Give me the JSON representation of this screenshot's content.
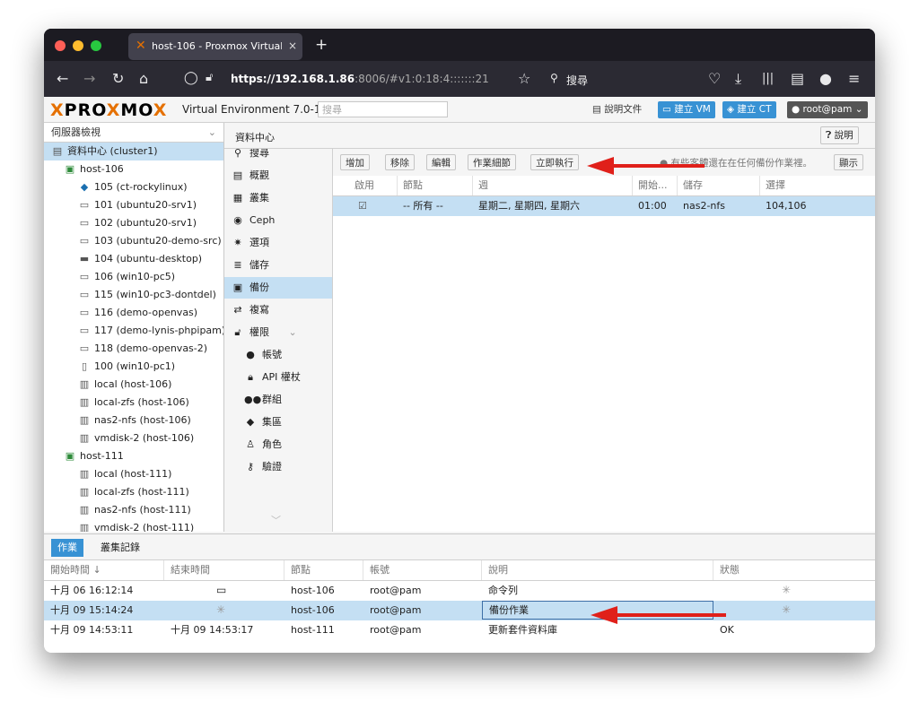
{
  "browser": {
    "tab_title": "host-106 - Proxmox Virtual Envi",
    "tab_close": "×",
    "new_tab": "+",
    "url_host": "https://192.168.1.86",
    "url_rest": ":8006/#v1:0:18:4:::::::21",
    "search_label": "搜尋",
    "nav": {
      "back": "←",
      "forward": "→",
      "reload": "↻",
      "home": "⌂",
      "star": "☆",
      "pocket": "♡",
      "download": "⤓",
      "library": "|||",
      "reader": "▤",
      "account": "●",
      "menu": "≡"
    }
  },
  "header": {
    "logo_a": "PRO",
    "logo_x": "X",
    "logo_b": "MO",
    "logo_x2": "X",
    "subtitle": "Virtual Environment 7.0-11",
    "search_placeholder": "搜尋",
    "docs_label": "說明文件",
    "create_vm_label": "建立 VM",
    "create_ct_label": "建立 CT",
    "user_label": "root@pam"
  },
  "tree": {
    "view_label": "伺服器檢視",
    "items": [
      {
        "label": "資料中心 (cluster1)",
        "icon": "datacenter-icon"
      },
      {
        "label": "host-106",
        "icon": "node-icon"
      },
      {
        "label": "105 (ct-rockylinux)",
        "icon": "container-icon"
      },
      {
        "label": "101 (ubuntu20-srv1)",
        "icon": "vm-icon"
      },
      {
        "label": "102 (ubuntu20-srv1)",
        "icon": "vm-icon"
      },
      {
        "label": "103 (ubuntu20-demo-src)",
        "icon": "vm-icon"
      },
      {
        "label": "104 (ubuntu-desktop)",
        "icon": "vm-running-icon"
      },
      {
        "label": "106 (win10-pc5)",
        "icon": "vm-icon"
      },
      {
        "label": "115 (win10-pc3-dontdel)",
        "icon": "vm-icon"
      },
      {
        "label": "116 (demo-openvas)",
        "icon": "vm-icon"
      },
      {
        "label": "117 (demo-lynis-phpipam)",
        "icon": "vm-icon"
      },
      {
        "label": "118 (demo-openvas-2)",
        "icon": "vm-icon"
      },
      {
        "label": "100 (win10-pc1)",
        "icon": "template-icon"
      },
      {
        "label": "local (host-106)",
        "icon": "storage-icon"
      },
      {
        "label": "local-zfs (host-106)",
        "icon": "storage-icon"
      },
      {
        "label": "nas2-nfs (host-106)",
        "icon": "storage-icon"
      },
      {
        "label": "vmdisk-2 (host-106)",
        "icon": "storage-icon"
      },
      {
        "label": "host-111",
        "icon": "node-icon"
      },
      {
        "label": "local (host-111)",
        "icon": "storage-icon"
      },
      {
        "label": "local-zfs (host-111)",
        "icon": "storage-icon"
      },
      {
        "label": "nas2-nfs (host-111)",
        "icon": "storage-icon"
      },
      {
        "label": "vmdisk-2 (host-111)",
        "icon": "storage-icon"
      }
    ]
  },
  "breadcrumb": "資料中心",
  "help_label": "說明",
  "nav_menu": [
    {
      "label": "搜尋",
      "icon": "search-icon"
    },
    {
      "label": "概觀",
      "icon": "book-icon"
    },
    {
      "label": "叢集",
      "icon": "server-icon"
    },
    {
      "label": "Ceph",
      "icon": "ceph-icon"
    },
    {
      "label": "選項",
      "icon": "gear-icon"
    },
    {
      "label": "儲存",
      "icon": "database-icon"
    },
    {
      "label": "備份",
      "icon": "floppy-icon"
    },
    {
      "label": "複寫",
      "icon": "retweet-icon"
    },
    {
      "label": "權限",
      "icon": "unlock-icon"
    },
    {
      "label": "帳號",
      "icon": "user-icon"
    },
    {
      "label": "API 權杖",
      "icon": "lock-icon"
    },
    {
      "label": "群組",
      "icon": "users-icon"
    },
    {
      "label": "集區",
      "icon": "tags-icon"
    },
    {
      "label": "角色",
      "icon": "male-icon"
    },
    {
      "label": "驗證",
      "icon": "key-icon"
    }
  ],
  "toolbar": {
    "add": "增加",
    "remove": "移除",
    "edit": "編輯",
    "job_detail": "作業細節",
    "run_now": "立即執行",
    "notice": "有些客體還在在任何備份作業裡。",
    "show": "顯示"
  },
  "backup_grid": {
    "columns": [
      "啟用",
      "節點",
      "週",
      "開始...",
      "儲存",
      "選擇"
    ],
    "rows": [
      {
        "enabled": "☑",
        "node": "-- 所有 --",
        "schedule": "星期二, 星期四, 星期六",
        "start": "01:00",
        "storage": "nas2-nfs",
        "selection": "104,106"
      }
    ]
  },
  "tasks": {
    "tab_tasks": "作業",
    "tab_cluster_log": "叢集記錄",
    "columns": [
      "開始時間 ↓",
      "結束時間",
      "節點",
      "帳號",
      "說明",
      "狀態"
    ],
    "rows": [
      {
        "start": "十月 06 16:12:14",
        "end": "",
        "end_icon": "console-icon",
        "node": "host-106",
        "user": "root@pam",
        "desc": "命令列",
        "status": "",
        "status_icon": "spinner-icon"
      },
      {
        "start": "十月 09 15:14:24",
        "end": "",
        "end_icon": "spinner-icon",
        "node": "host-106",
        "user": "root@pam",
        "desc": "備份作業",
        "status": "",
        "status_icon": "spinner-icon"
      },
      {
        "start": "十月 09 14:53:11",
        "end": "十月 09 14:53:17",
        "end_icon": "",
        "node": "host-111",
        "user": "root@pam",
        "desc": "更新套件資料庫",
        "status": "OK",
        "status_icon": ""
      }
    ]
  },
  "colors": {
    "accent": "#3892d4",
    "selection": "#c4dff3",
    "logo_orange": "#e57000",
    "annotation": "#e0201a"
  }
}
